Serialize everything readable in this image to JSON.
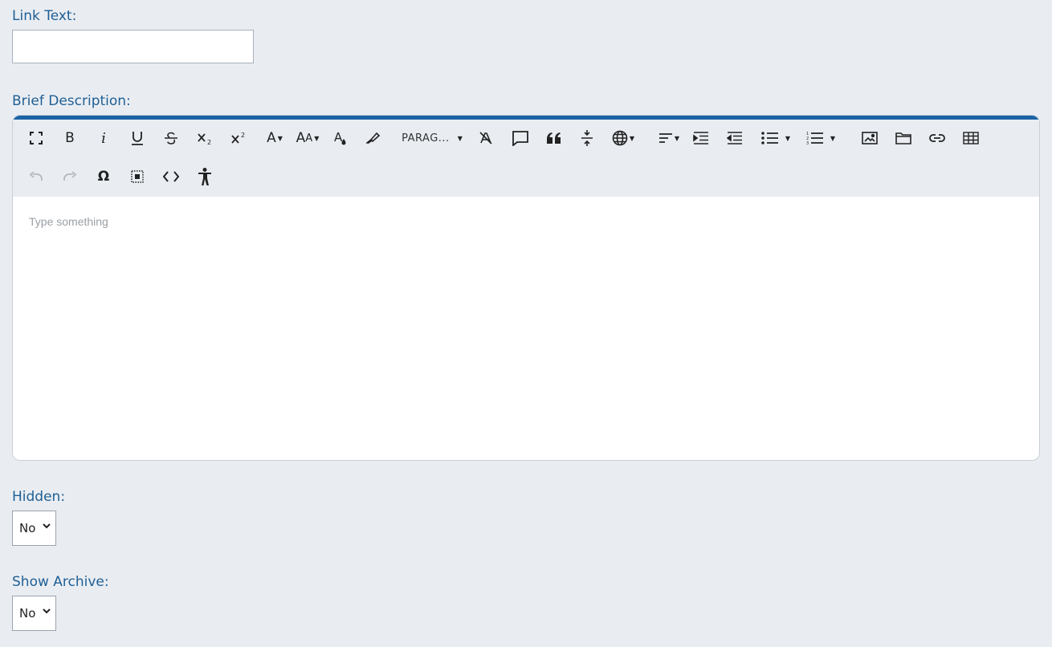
{
  "link_text": {
    "label": "Link Text:",
    "value": ""
  },
  "brief_description": {
    "label": "Brief Description:",
    "placeholder": "Type something",
    "toolbar": {
      "paragraph_label": "PARAG...",
      "buttons": [
        "fullscreen-icon",
        "bold-icon",
        "italic-icon",
        "underline-icon",
        "strikethrough-icon",
        "subscript-icon",
        "superscript-icon",
        "font-color-icon",
        "font-size-icon",
        "text-color-icon",
        "highlight-icon",
        "paragraph-format",
        "clear-format-icon",
        "comment-icon",
        "quote-icon",
        "horizontal-line-icon",
        "language-icon",
        "align-icon",
        "indent-icon",
        "outdent-icon",
        "bullet-list-icon",
        "numbered-list-icon",
        "image-icon",
        "folder-icon",
        "link-icon",
        "table-icon",
        "undo-icon",
        "redo-icon",
        "special-char-icon",
        "select-all-icon",
        "code-view-icon",
        "accessibility-icon"
      ]
    }
  },
  "hidden": {
    "label": "Hidden:",
    "value": "No"
  },
  "show_archive": {
    "label": "Show Archive:",
    "value": "No"
  },
  "colors": {
    "accent": "#1b63a6",
    "label": "#1f5f94",
    "background": "#e9edf2"
  }
}
